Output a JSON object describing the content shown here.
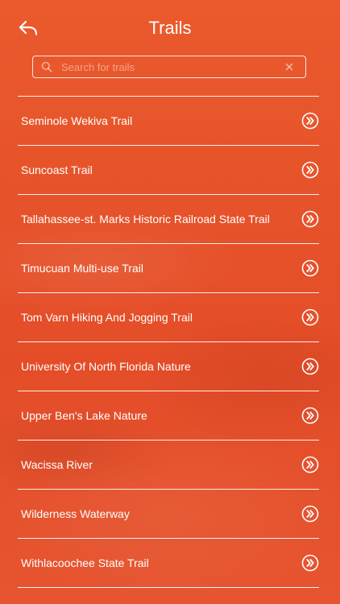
{
  "header": {
    "title": "Trails",
    "back_icon": "back-arrow-icon"
  },
  "search": {
    "placeholder": "Search for trails",
    "value": "",
    "icon": "search-icon",
    "clear_icon": "clear-icon"
  },
  "trails": {
    "items": [
      {
        "label": "Seminole Wekiva Trail"
      },
      {
        "label": "Suncoast Trail"
      },
      {
        "label": "Tallahassee-st. Marks Historic Railroad State Trail"
      },
      {
        "label": "Timucuan Multi-use Trail"
      },
      {
        "label": "Tom Varn Hiking And Jogging Trail"
      },
      {
        "label": "University Of North Florida Nature"
      },
      {
        "label": "Upper Ben's Lake Nature"
      },
      {
        "label": "Wacissa River"
      },
      {
        "label": "Wilderness Waterway"
      },
      {
        "label": "Withlacoochee State Trail"
      }
    ],
    "item_icon": "double-chevron-right-icon"
  },
  "theme": {
    "accent": "#e8542a",
    "text": "#ffffff"
  }
}
